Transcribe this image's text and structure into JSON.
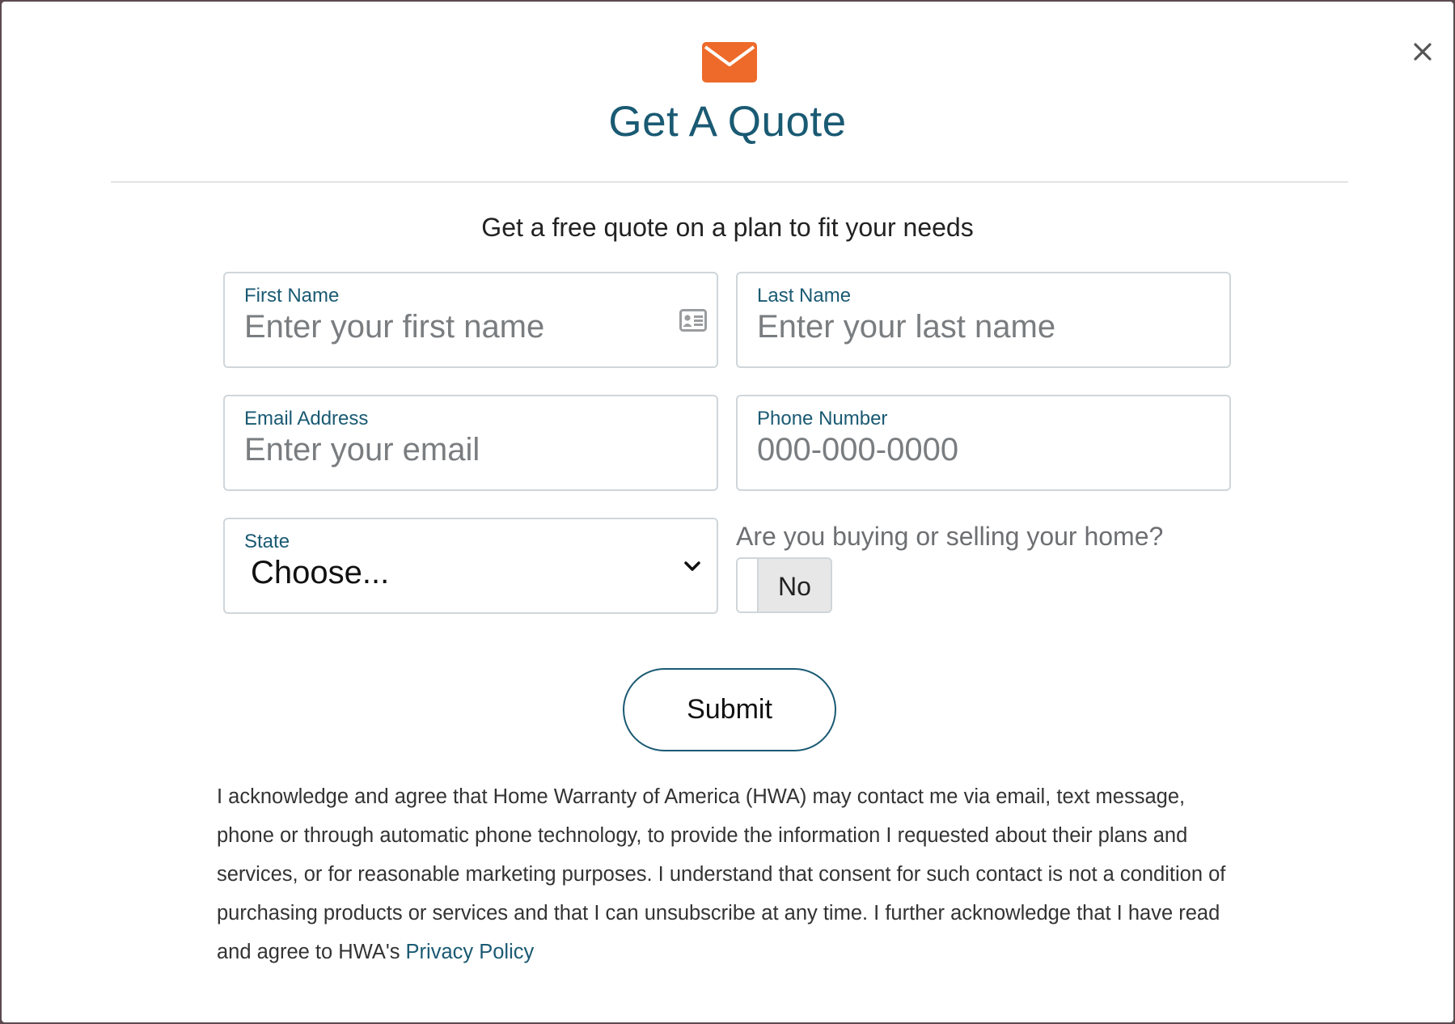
{
  "modal": {
    "title": "Get A Quote",
    "subtitle": "Get a free quote on a plan to fit your needs",
    "close_icon": "close-icon",
    "header_icon": "envelope-icon",
    "accent_color": "#ee6a2a",
    "title_color": "#1a5a73"
  },
  "form": {
    "first_name": {
      "label": "First Name",
      "placeholder": "Enter your first name"
    },
    "last_name": {
      "label": "Last Name",
      "placeholder": "Enter your last name"
    },
    "email": {
      "label": "Email Address",
      "placeholder": "Enter your email"
    },
    "phone": {
      "label": "Phone Number",
      "placeholder": "000-000-0000"
    },
    "state": {
      "label": "State",
      "selected": "Choose..."
    },
    "buying_selling": {
      "question": "Are you buying or selling your home?",
      "value": "No"
    },
    "submit_label": "Submit"
  },
  "disclaimer": {
    "text": "I acknowledge and agree that Home Warranty of America (HWA) may contact me via email, text message, phone or through automatic phone technology, to provide the information I requested about their plans and services, or for reasonable marketing purposes. I understand that consent for such contact is not a condition of purchasing products or services and that I can unsubscribe at any time. I further acknowledge that I have read and agree to HWA's ",
    "link_text": "Privacy Policy"
  }
}
